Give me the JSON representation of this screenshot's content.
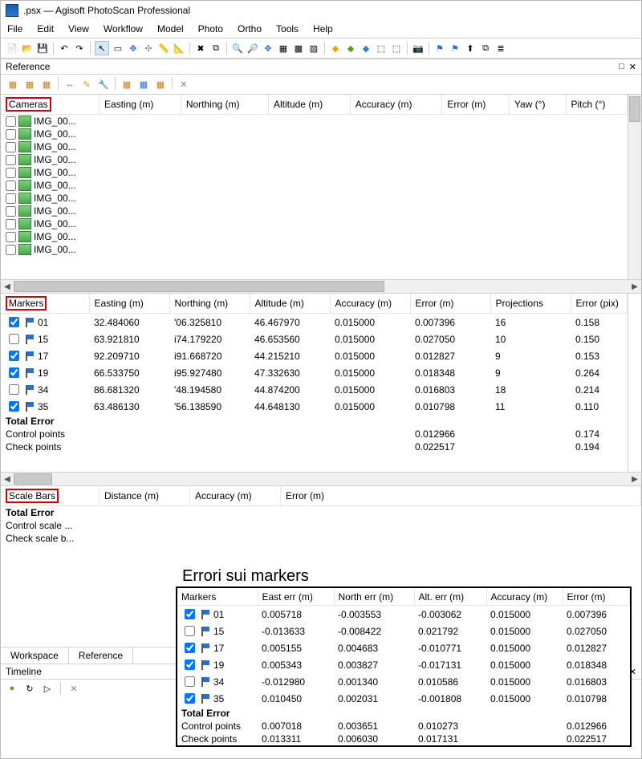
{
  "title": ".psx  —  Agisoft PhotoScan Professional",
  "menu": [
    "File",
    "Edit",
    "View",
    "Workflow",
    "Model",
    "Photo",
    "Ortho",
    "Tools",
    "Help"
  ],
  "panel": {
    "reference": "Reference",
    "timeline": "Timeline",
    "tabs": {
      "workspace": "Workspace",
      "reference": "Reference"
    }
  },
  "sections": {
    "cameras": "Cameras",
    "markers": "Markers",
    "scalebars": "Scale Bars",
    "totalerror": "Total Error",
    "controlpoints": "Control points",
    "checkpoints": "Check points",
    "controlscale": "Control scale ...",
    "checkscale": "Check scale b..."
  },
  "headers": {
    "easting": "Easting (m)",
    "northing": "Northing (m)",
    "altitude": "Altitude (m)",
    "accuracy": "Accuracy (m)",
    "error": "Error (m)",
    "yaw": "Yaw (°)",
    "pitch": "Pitch (°)",
    "projections": "Projections",
    "errorpix": "Error (pix)",
    "distance": "Distance (m)"
  },
  "cameras": [
    "IMG_00...",
    "IMG_00...",
    "IMG_00...",
    "IMG_00...",
    "IMG_00...",
    "IMG_00...",
    "IMG_00...",
    "IMG_00...",
    "IMG_00...",
    "IMG_00...",
    "IMG_00..."
  ],
  "markers": [
    {
      "chk": true,
      "name": "01",
      "e": "32.484060",
      "n": "'06.325810",
      "a": "46.467970",
      "acc": "0.015000",
      "err": "0.007396",
      "proj": "16",
      "ep": "0.158"
    },
    {
      "chk": false,
      "name": "15",
      "e": "63.921810",
      "n": "i74.179220",
      "a": "46.653560",
      "acc": "0.015000",
      "err": "0.027050",
      "proj": "10",
      "ep": "0.150"
    },
    {
      "chk": true,
      "name": "17",
      "e": "92.209710",
      "n": "i91.668720",
      "a": "44.215210",
      "acc": "0.015000",
      "err": "0.012827",
      "proj": "9",
      "ep": "0.153"
    },
    {
      "chk": true,
      "name": "19",
      "e": "66.533750",
      "n": "i95.927480",
      "a": "47.332630",
      "acc": "0.015000",
      "err": "0.018348",
      "proj": "9",
      "ep": "0.264"
    },
    {
      "chk": false,
      "name": "34",
      "e": "86.681320",
      "n": "'48.194580",
      "a": "44.874200",
      "acc": "0.015000",
      "err": "0.016803",
      "proj": "18",
      "ep": "0.214"
    },
    {
      "chk": true,
      "name": "35",
      "e": "63.486130",
      "n": "'56.138590",
      "a": "44.648130",
      "acc": "0.015000",
      "err": "0.010798",
      "proj": "11",
      "ep": "0.110"
    }
  ],
  "markers_totals": {
    "control": {
      "err": "0.012966",
      "ep": "0.174"
    },
    "check": {
      "err": "0.022517",
      "ep": "0.194"
    }
  },
  "overlay": {
    "title": "Errori sui markers",
    "headers": {
      "markers": "Markers",
      "east": "East err (m)",
      "north": "North err (m)",
      "alt": "Alt. err (m)",
      "acc": "Accuracy (m)",
      "err": "Error (m)"
    },
    "rows": [
      {
        "chk": true,
        "name": "01",
        "e": "0.005718",
        "n": "-0.003553",
        "a": "-0.003062",
        "acc": "0.015000",
        "err": "0.007396"
      },
      {
        "chk": false,
        "name": "15",
        "e": "-0.013633",
        "n": "-0.008422",
        "a": "0.021792",
        "acc": "0.015000",
        "err": "0.027050"
      },
      {
        "chk": true,
        "name": "17",
        "e": "0.005155",
        "n": "0.004683",
        "a": "-0.010771",
        "acc": "0.015000",
        "err": "0.012827"
      },
      {
        "chk": true,
        "name": "19",
        "e": "0.005343",
        "n": "0.003827",
        "a": "-0.017131",
        "acc": "0.015000",
        "err": "0.018348"
      },
      {
        "chk": false,
        "name": "34",
        "e": "-0.012980",
        "n": "0.001340",
        "a": "0.010586",
        "acc": "0.015000",
        "err": "0.016803"
      },
      {
        "chk": true,
        "name": "35",
        "e": "0.010450",
        "n": "0.002031",
        "a": "-0.001808",
        "acc": "0.015000",
        "err": "0.010798"
      }
    ],
    "totals": {
      "control": {
        "e": "0.007018",
        "n": "0.003651",
        "a": "0.010273",
        "err": "0.012966"
      },
      "check": {
        "e": "0.013311",
        "n": "0.006030",
        "a": "0.017131",
        "err": "0.022517"
      }
    }
  }
}
